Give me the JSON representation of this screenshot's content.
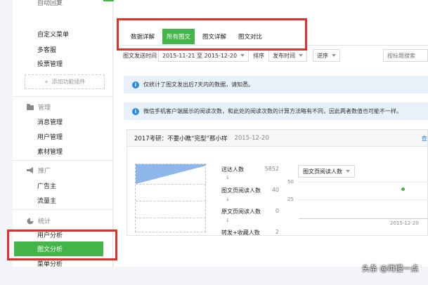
{
  "sidebar": {
    "items_top": [
      "自动回复",
      "自定义菜单",
      "多客服",
      "投票管理"
    ],
    "add_plugin": "添加功能插件",
    "groups": [
      {
        "title": "管理",
        "icon": "folder-icon",
        "items": [
          "消息管理",
          "用户管理",
          "素材管理"
        ]
      },
      {
        "title": "推广",
        "icon": "megaphone-icon",
        "items": [
          "广告主",
          "流量主"
        ]
      },
      {
        "title": "统计",
        "icon": "pie-chart-icon",
        "items": [
          "用户分析",
          "图文分析",
          "菜单分析"
        ]
      }
    ],
    "active": "图文分析"
  },
  "tabs": [
    "数据详解",
    "所有图文",
    "图文详解",
    "图文对比"
  ],
  "filter": {
    "date_label": "图文发送时间",
    "date_range": "2015-11-21 至 2015-12-20",
    "sort_label": "排序",
    "sort_by": "发布时间",
    "order": "逆序",
    "search_placeholder": "按标题搜索"
  },
  "notices": [
    "仅统计了图文发出后7天内的数据，请知悉。",
    "微信手机客户端展示的阅读次数，和此处的阅读次数的计算方法略有不同，因此两者数值也可能不一样。"
  ],
  "article": {
    "title": "2017考研：不要小瞧“完型”那小样",
    "date": "2015-12-20",
    "more": "查",
    "metrics": [
      {
        "label": "送达人数",
        "value": "5852"
      },
      {
        "label": "图文页阅读人数",
        "value": "40"
      },
      {
        "label": "原文页阅读人数",
        "value": "0"
      },
      {
        "label": "转发+收藏人数",
        "value": "2"
      }
    ],
    "chart_select": "图文页阅读人数",
    "chart": {
      "y_ticks": [
        "50",
        "25"
      ],
      "x_tick": "2015-12-20"
    }
  },
  "colors": {
    "accent": "#44b549",
    "highlight": "#e0302b",
    "info": "#2d8ae3"
  },
  "watermark": "头条 @再慢一点"
}
